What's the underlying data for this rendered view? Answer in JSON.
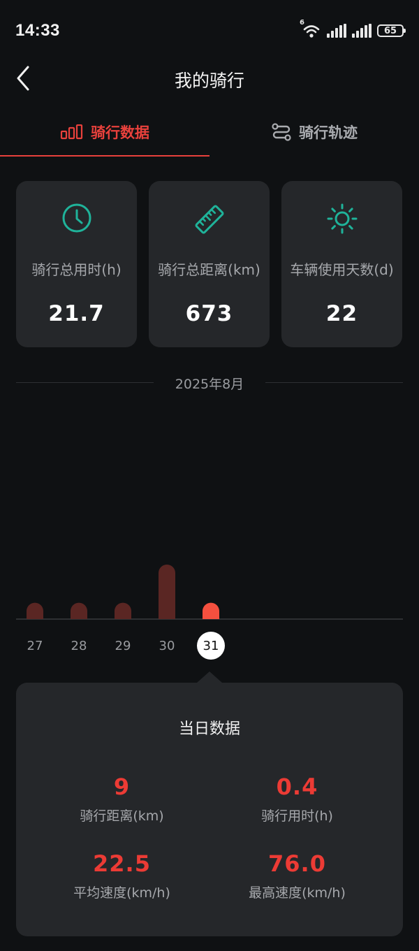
{
  "status_bar": {
    "time": "14:33",
    "battery": "65",
    "wifi_badge": "6"
  },
  "header": {
    "title": "我的骑行"
  },
  "tabs": [
    {
      "label": "骑行数据",
      "active": true,
      "icon": "bar-chart-icon"
    },
    {
      "label": "骑行轨迹",
      "active": false,
      "icon": "route-icon"
    }
  ],
  "stats": [
    {
      "label": "骑行总用时(h)",
      "value": "21.7",
      "icon": "clock-icon"
    },
    {
      "label": "骑行总距离(km)",
      "value": "673",
      "icon": "ruler-icon"
    },
    {
      "label": "车辆使用天数(d)",
      "value": "22",
      "icon": "sun-icon"
    }
  ],
  "month": "2025年8月",
  "chart_data": {
    "type": "bar",
    "categories": [
      "27",
      "28",
      "29",
      "30",
      "31"
    ],
    "values": [
      9,
      9,
      9,
      30,
      9
    ],
    "selected": "31"
  },
  "daily": {
    "title": "当日数据",
    "metrics": [
      {
        "value": "9",
        "label": "骑行距离(km)"
      },
      {
        "value": "0.4",
        "label": "骑行用时(h)"
      },
      {
        "value": "22.5",
        "label": "平均速度(km/h)"
      },
      {
        "value": "76.0",
        "label": "最高速度(km/h)"
      }
    ]
  },
  "colors": {
    "accent": "#e8413c",
    "teal": "#1fb39a",
    "background": "#0f1113",
    "card": "#25272a"
  }
}
